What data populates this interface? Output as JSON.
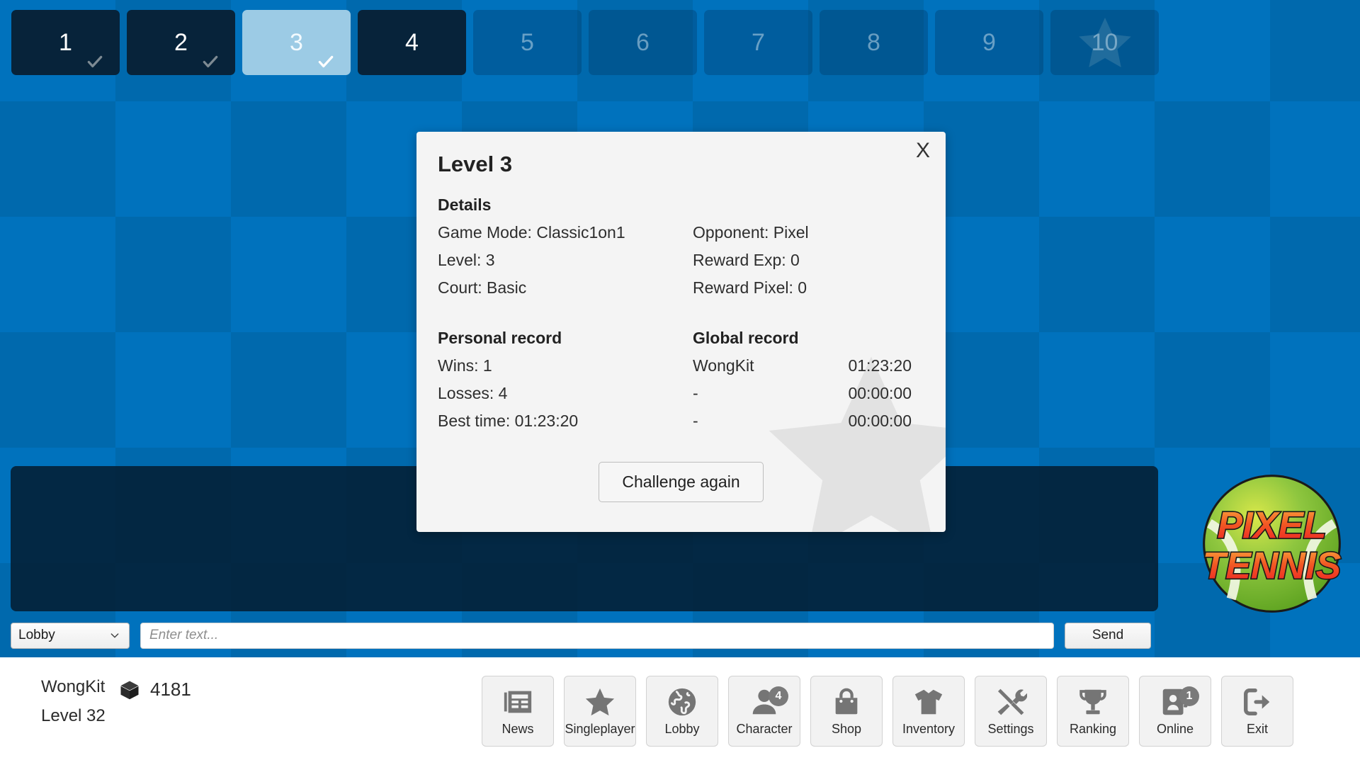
{
  "levels": [
    {
      "label": "1",
      "state": "completed",
      "check": true,
      "star": false
    },
    {
      "label": "2",
      "state": "completed",
      "check": true,
      "star": false
    },
    {
      "label": "3",
      "state": "selected",
      "check": true,
      "star": false
    },
    {
      "label": "4",
      "state": "completed",
      "check": false,
      "star": false
    },
    {
      "label": "5",
      "state": "locked",
      "check": false,
      "star": false
    },
    {
      "label": "6",
      "state": "locked",
      "check": false,
      "star": false
    },
    {
      "label": "7",
      "state": "locked",
      "check": false,
      "star": false
    },
    {
      "label": "8",
      "state": "locked",
      "check": false,
      "star": false
    },
    {
      "label": "9",
      "state": "locked",
      "check": false,
      "star": false
    },
    {
      "label": "10",
      "state": "locked",
      "check": false,
      "star": true
    }
  ],
  "modal": {
    "title": "Level 3",
    "close_label": "X",
    "details_heading": "Details",
    "details_left": [
      "Game Mode: Classic1on1",
      "Level: 3",
      "Court: Basic"
    ],
    "details_right": [
      "Opponent: Pixel",
      "Reward Exp: 0",
      "Reward Pixel: 0"
    ],
    "personal_heading": "Personal record",
    "personal_rows": [
      "Wins: 1",
      "Losses: 4",
      "Best time: 01:23:20"
    ],
    "global_heading": "Global record",
    "global_rows": [
      {
        "name": "WongKit",
        "time": "01:23:20"
      },
      {
        "name": "-",
        "time": "00:00:00"
      },
      {
        "name": "-",
        "time": "00:00:00"
      }
    ],
    "challenge_label": "Challenge again"
  },
  "chat": {
    "channel": "Lobby",
    "channel_options": [
      "Lobby"
    ],
    "input_value": "",
    "placeholder": "Enter text...",
    "send_label": "Send"
  },
  "logo": {
    "line1": "PIXEL",
    "line2": "TENNIS"
  },
  "player": {
    "name": "WongKit",
    "level": "Level 32",
    "currency_amount": "4181",
    "currency_icon": "cube-icon"
  },
  "nav": [
    {
      "label": "News",
      "icon": "newspaper-icon",
      "badge": null
    },
    {
      "label": "Singleplayer",
      "icon": "star-icon",
      "badge": null
    },
    {
      "label": "Lobby",
      "icon": "globe-icon",
      "badge": null
    },
    {
      "label": "Character",
      "icon": "person-icon",
      "badge": "4"
    },
    {
      "label": "Shop",
      "icon": "bag-icon",
      "badge": null
    },
    {
      "label": "Inventory",
      "icon": "tshirt-icon",
      "badge": null
    },
    {
      "label": "Settings",
      "icon": "tools-icon",
      "badge": null
    },
    {
      "label": "Ranking",
      "icon": "trophy-icon",
      "badge": null
    },
    {
      "label": "Online",
      "icon": "contacts-icon",
      "badge": "1"
    },
    {
      "label": "Exit",
      "icon": "exit-icon",
      "badge": null
    }
  ],
  "colors": {
    "background_blue": "#0072bd",
    "background_blue_alt": "#0069ad",
    "tile_completed": "#07233a",
    "tile_selected": "#9ccbe5",
    "modal_bg": "#f4f4f4",
    "icon_gray": "#757575",
    "logo_ball": "#8dc63f",
    "logo_text": "#f15a24"
  }
}
